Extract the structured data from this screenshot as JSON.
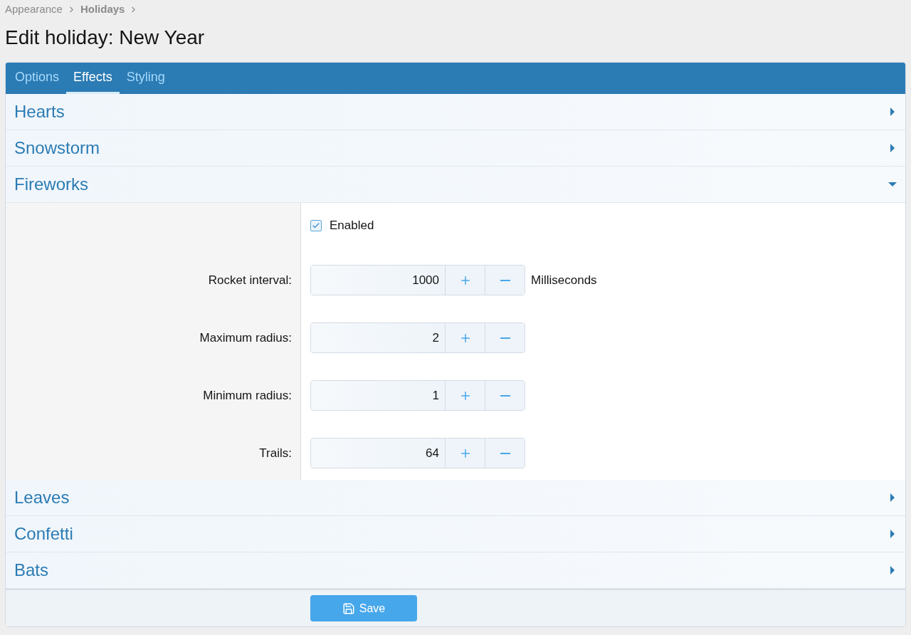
{
  "breadcrumb": [
    {
      "label": "Appearance",
      "bold": false
    },
    {
      "label": "Holidays",
      "bold": true
    }
  ],
  "title": "Edit holiday: New Year",
  "tabs": [
    {
      "label": "Options",
      "selected": false
    },
    {
      "label": "Effects",
      "selected": true
    },
    {
      "label": "Styling",
      "selected": false
    }
  ],
  "sections": [
    {
      "title": "Hearts",
      "expanded": false
    },
    {
      "title": "Snowstorm",
      "expanded": false
    },
    {
      "title": "Fireworks",
      "expanded": true,
      "checkbox": {
        "label": "Enabled",
        "checked": true
      },
      "fields": [
        {
          "label": "Rocket interval:",
          "value": "1000",
          "units": "Milliseconds"
        },
        {
          "label": "Maximum radius:",
          "value": "2"
        },
        {
          "label": "Minimum radius:",
          "value": "1"
        },
        {
          "label": "Trails:",
          "value": "64"
        }
      ]
    },
    {
      "title": "Leaves",
      "expanded": false
    },
    {
      "title": "Confetti",
      "expanded": false
    },
    {
      "title": "Bats",
      "expanded": false
    }
  ],
  "save_button": "Save"
}
